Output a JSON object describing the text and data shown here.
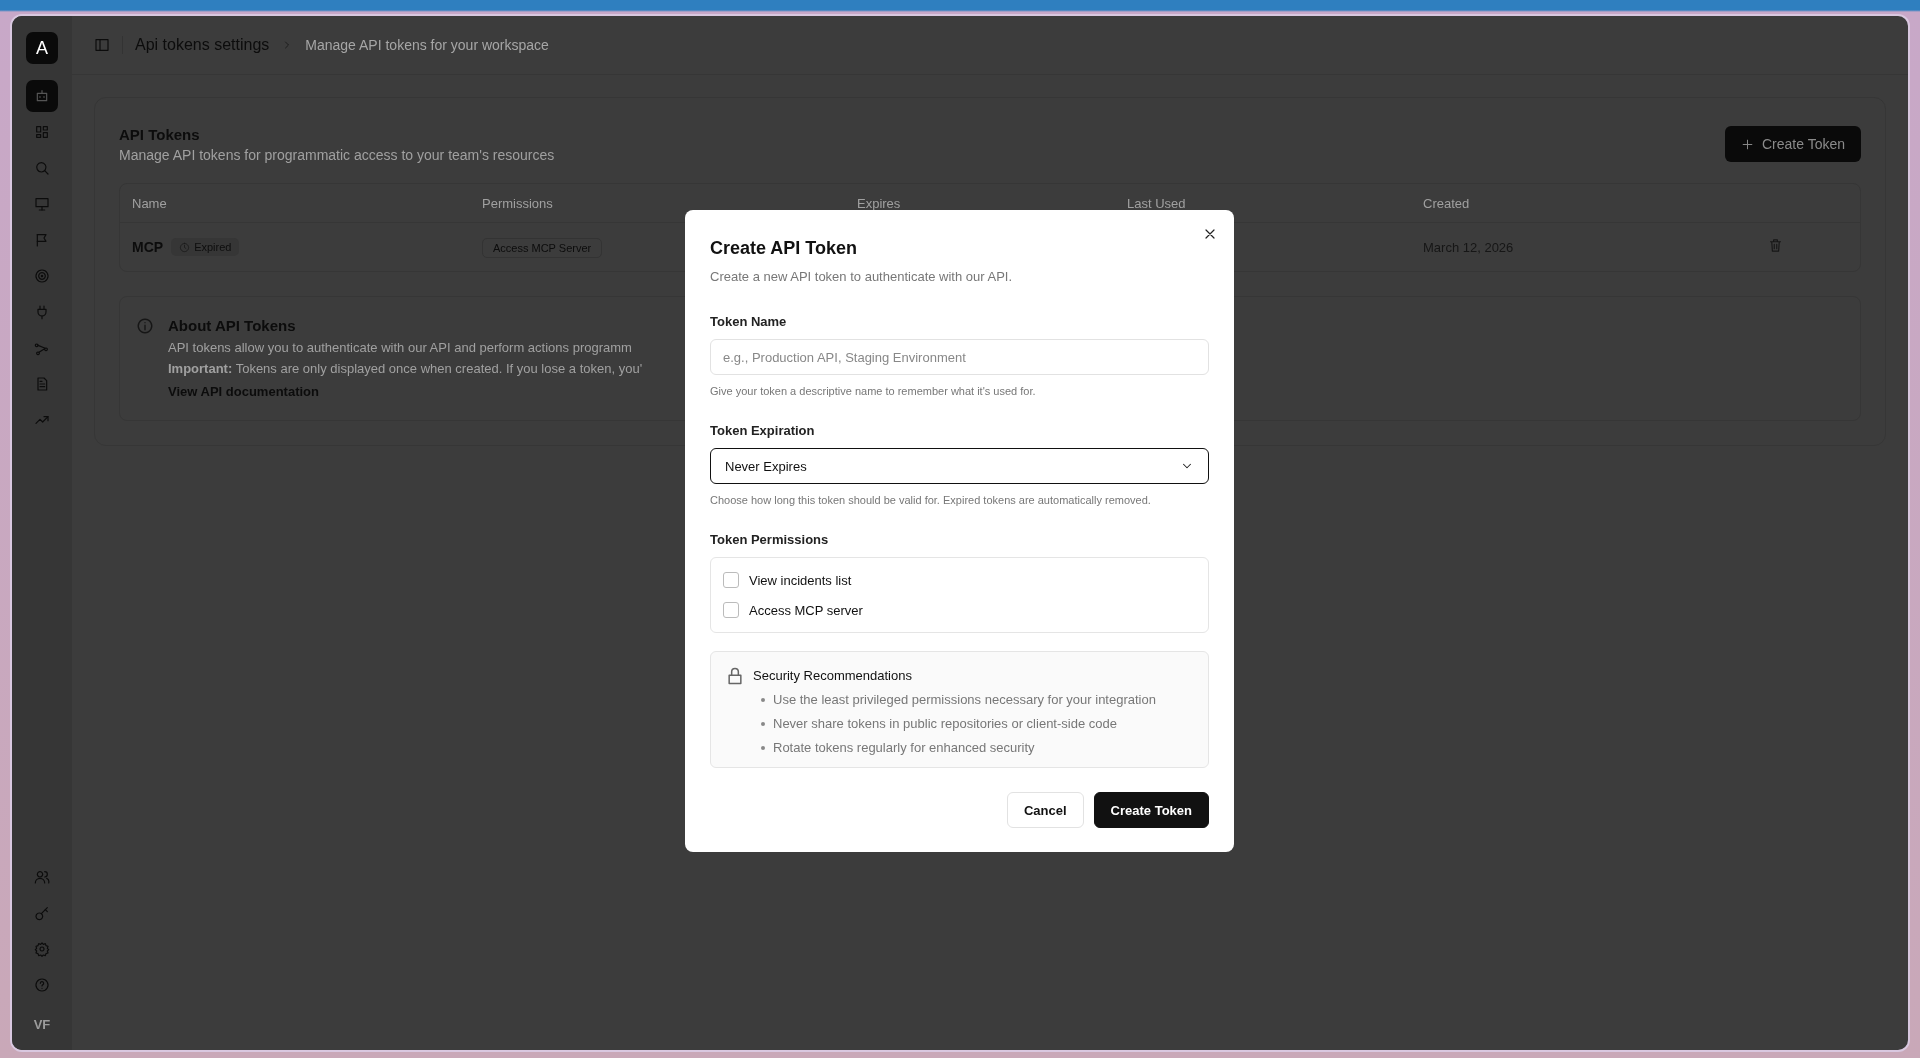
{
  "sidebar": {
    "logo": "A",
    "items": [
      {
        "selected": true
      },
      {
        "selected": false
      },
      {
        "selected": false
      },
      {
        "selected": false
      },
      {
        "selected": false
      },
      {
        "selected": false
      },
      {
        "selected": false
      },
      {
        "selected": false
      },
      {
        "selected": false
      },
      {
        "selected": false
      }
    ],
    "bottom_items": [
      {
        "selected": false
      },
      {
        "selected": false
      },
      {
        "selected": false
      },
      {
        "selected": false
      }
    ],
    "user_initials": "VF"
  },
  "header": {
    "title": "Api tokens settings",
    "subtitle": "Manage API tokens for your workspace"
  },
  "page": {
    "title": "API Tokens",
    "description": "Manage API tokens for programmatic access to your team's resources",
    "create_button": "Create Token",
    "table": {
      "columns": [
        "Name",
        "Permissions",
        "Expires",
        "Last Used",
        "Created"
      ],
      "rows": [
        {
          "name": "MCP",
          "status": "Expired",
          "permission": "Access MCP Server",
          "created": "March 12, 2026"
        }
      ]
    },
    "about": {
      "title": "About API Tokens",
      "text": "API tokens allow you to authenticate with our API and perform actions programm",
      "important": "**Important:** Tokens are only displayed once when created. If you lose a token, you'",
      "link": "View API documentation"
    }
  },
  "modal": {
    "title": "Create API Token",
    "description": "Create a new API token to authenticate with our API.",
    "name_label": "Token Name",
    "name_placeholder": "e.g., Production API, Staging Environment",
    "name_help": "Give your token a descriptive name to remember what it's used for.",
    "expiration_label": "Token Expiration",
    "expiration_value": "Never Expires",
    "expiration_help": "Choose how long this token should be valid for. Expired tokens are automatically removed.",
    "permissions_label": "Token Permissions",
    "permissions": [
      {
        "label": "View incidents list",
        "checked": false
      },
      {
        "label": "Access MCP server",
        "checked": false
      }
    ],
    "security": {
      "title": "Security Recommendations",
      "items": [
        "Use the least privileged permissions necessary for your integration",
        "Never share tokens in public repositories or client-side code",
        "Rotate tokens regularly for enhanced security"
      ]
    },
    "buttons": [
      "Cancel",
      "Create Token"
    ]
  }
}
